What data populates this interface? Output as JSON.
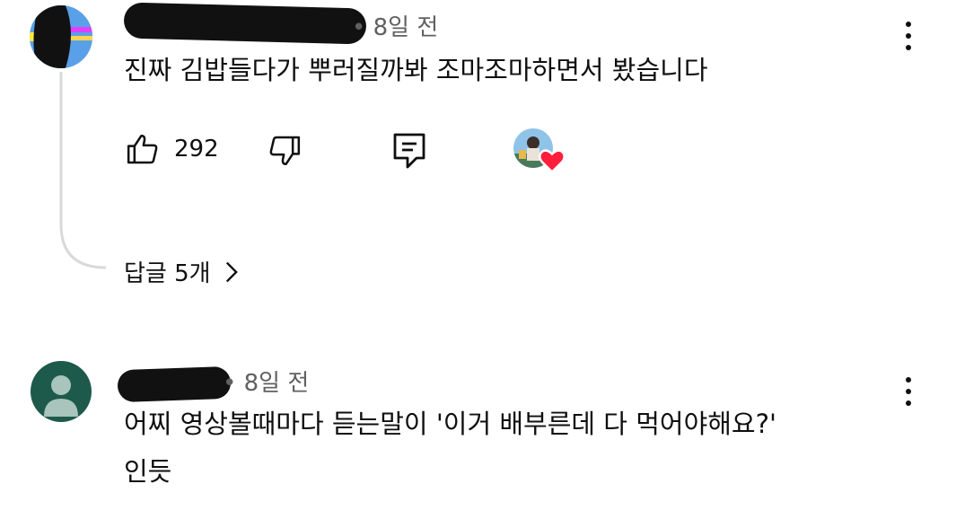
{
  "colors": {
    "text": "#0f0f0f",
    "meta": "#606060",
    "thread_line": "#d9d9d9",
    "heart": "#ff1f3d",
    "avatar2_bg": "#1e5a4c"
  },
  "comments": [
    {
      "author": "",
      "time": "• 8일 전",
      "text": "진짜 김밥들다가 뿌러질까봐 조마조마하면서 봤습니다",
      "likes": "292",
      "icons": {
        "like": "thumb-up-icon",
        "dislike": "thumb-down-icon",
        "reply": "reply-icon",
        "menu": "kebab-menu-icon",
        "creator_heart": "heart-icon"
      },
      "replies_label": "답글 5개"
    },
    {
      "author": "",
      "time": "• 8일 전",
      "text_line1": "어찌 영상볼때마다 듣는말이 '이거 배부른데 다 먹어야해요?'",
      "text_line2": "인듯",
      "icons": {
        "menu": "kebab-menu-icon",
        "avatar": "person-icon"
      }
    }
  ]
}
